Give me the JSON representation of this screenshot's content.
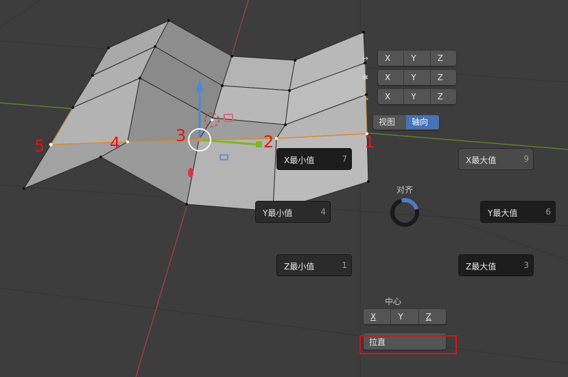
{
  "rows": [
    {
      "icon": "↔",
      "x": "X",
      "y": "Y",
      "z": "Z"
    },
    {
      "icon": "✱",
      "x": "X",
      "y": "Y",
      "z": "Z"
    },
    {
      "icon": "⤡",
      "x": "X",
      "y": "Y",
      "z": "Z"
    }
  ],
  "toggle": {
    "view": "视图",
    "axis": "轴向"
  },
  "fields": {
    "x_min": {
      "label": "X最小值",
      "value": "7"
    },
    "x_max": {
      "label": "X最大值",
      "value": "9"
    },
    "y_min": {
      "label": "Y最小值",
      "value": "4"
    },
    "y_max": {
      "label": "Y最大值",
      "value": "6"
    },
    "z_min": {
      "label": "Z最小值",
      "value": "1"
    },
    "z_max": {
      "label": "Z最大值",
      "value": "3"
    }
  },
  "align": {
    "label": "对齐"
  },
  "center": {
    "label": "中心",
    "x": "X",
    "y": "Y",
    "z": "Z"
  },
  "straighten": {
    "label": "拉直"
  },
  "markers": [
    "1",
    "2",
    "3",
    "4",
    "5"
  ]
}
